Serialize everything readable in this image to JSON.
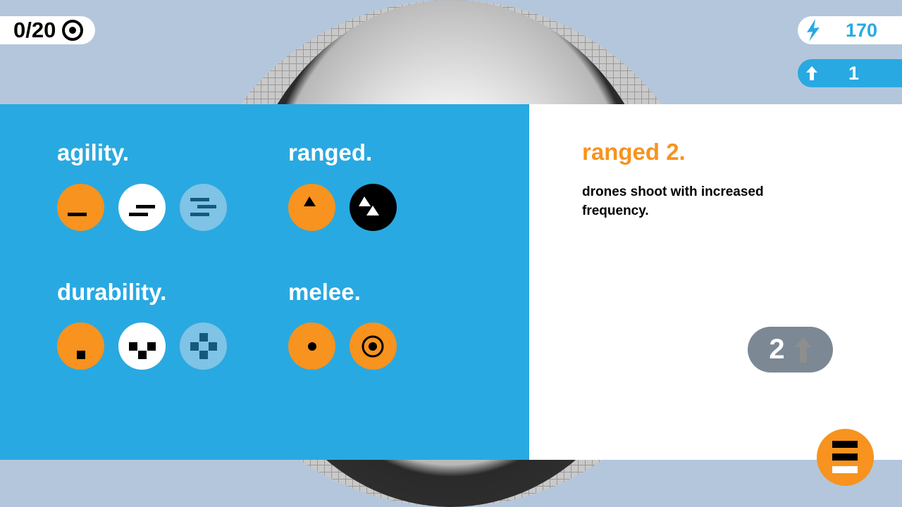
{
  "hud": {
    "goal": "0/20",
    "energy": "170",
    "upgrade_points": "1"
  },
  "categories": [
    {
      "label": "agility.",
      "levels": [
        "agility-1",
        "agility-2",
        "agility-3"
      ]
    },
    {
      "label": "ranged.",
      "levels": [
        "ranged-1",
        "ranged-2"
      ]
    },
    {
      "label": "durability.",
      "levels": [
        "durability-1",
        "durability-2",
        "durability-3"
      ]
    },
    {
      "label": "melee.",
      "levels": [
        "melee-1",
        "melee-2"
      ]
    }
  ],
  "detail": {
    "title": "ranged 2.",
    "description": "drones shoot with increased frequency.",
    "cost": "2"
  },
  "colors": {
    "panel": "#29a9e1",
    "accent": "#f7931e",
    "owned": "#f7931e",
    "available": "#ffffff",
    "locked": "#7fc3e6",
    "selected": "#000000",
    "disabled": "#7c8894"
  }
}
